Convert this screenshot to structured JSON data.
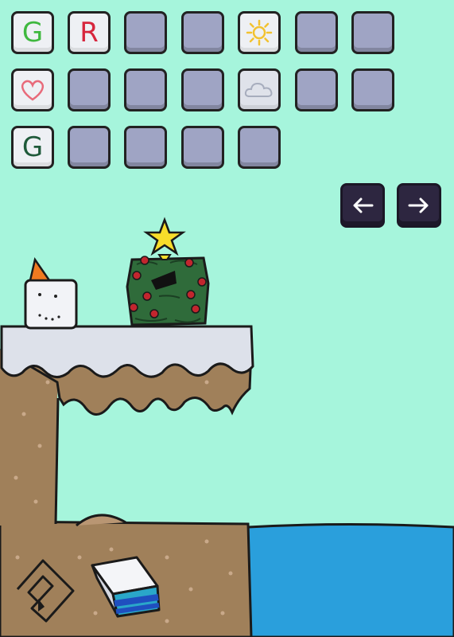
{
  "inventory": {
    "rows": [
      [
        {
          "kind": "letter",
          "text": "G",
          "color": "#3fb83f"
        },
        {
          "kind": "letter",
          "text": "R",
          "color": "#d7263d"
        },
        {
          "kind": "empty"
        },
        {
          "kind": "empty"
        },
        {
          "kind": "icon",
          "icon": "sun-icon"
        },
        {
          "kind": "empty"
        },
        {
          "kind": "empty"
        }
      ],
      [
        {
          "kind": "icon",
          "icon": "heart-icon"
        },
        {
          "kind": "empty"
        },
        {
          "kind": "empty"
        },
        {
          "kind": "empty"
        },
        {
          "kind": "icon",
          "icon": "cloud-icon"
        },
        {
          "kind": "empty"
        },
        {
          "kind": "empty"
        }
      ],
      [
        {
          "kind": "letter",
          "text": "G",
          "color": "#1f5a3a"
        },
        {
          "kind": "empty"
        },
        {
          "kind": "empty"
        },
        {
          "kind": "empty"
        },
        {
          "kind": "empty"
        }
      ]
    ]
  },
  "nav": {
    "prev_icon": "arrow-left-icon",
    "next_icon": "arrow-right-icon"
  },
  "colors": {
    "background": "#a6f5dc",
    "water": "#2a9fdc",
    "dirt": "#a0805a",
    "snow": "#dde1ea",
    "tree": "#2f6b3a"
  },
  "tools": {
    "undo_icon": "undo-spiral-icon",
    "eraser_icon": "eraser-icon"
  }
}
